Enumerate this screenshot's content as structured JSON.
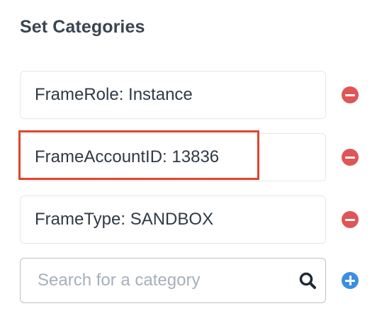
{
  "panel": {
    "title": "Set Categories"
  },
  "categories": [
    {
      "label": "FrameRole: Instance",
      "remove_icon": "minus-circle-icon"
    },
    {
      "label": "FrameAccountID: 13836",
      "remove_icon": "minus-circle-icon"
    },
    {
      "label": "FrameType: SANDBOX",
      "remove_icon": "minus-circle-icon"
    }
  ],
  "search": {
    "placeholder": "Search for a category",
    "value": "",
    "icon": "search-icon",
    "add_icon": "plus-circle-icon"
  },
  "colors": {
    "remove": "#e05555",
    "add": "#3b8fe0",
    "highlight": "#e0452b",
    "text": "#2f3a45"
  }
}
